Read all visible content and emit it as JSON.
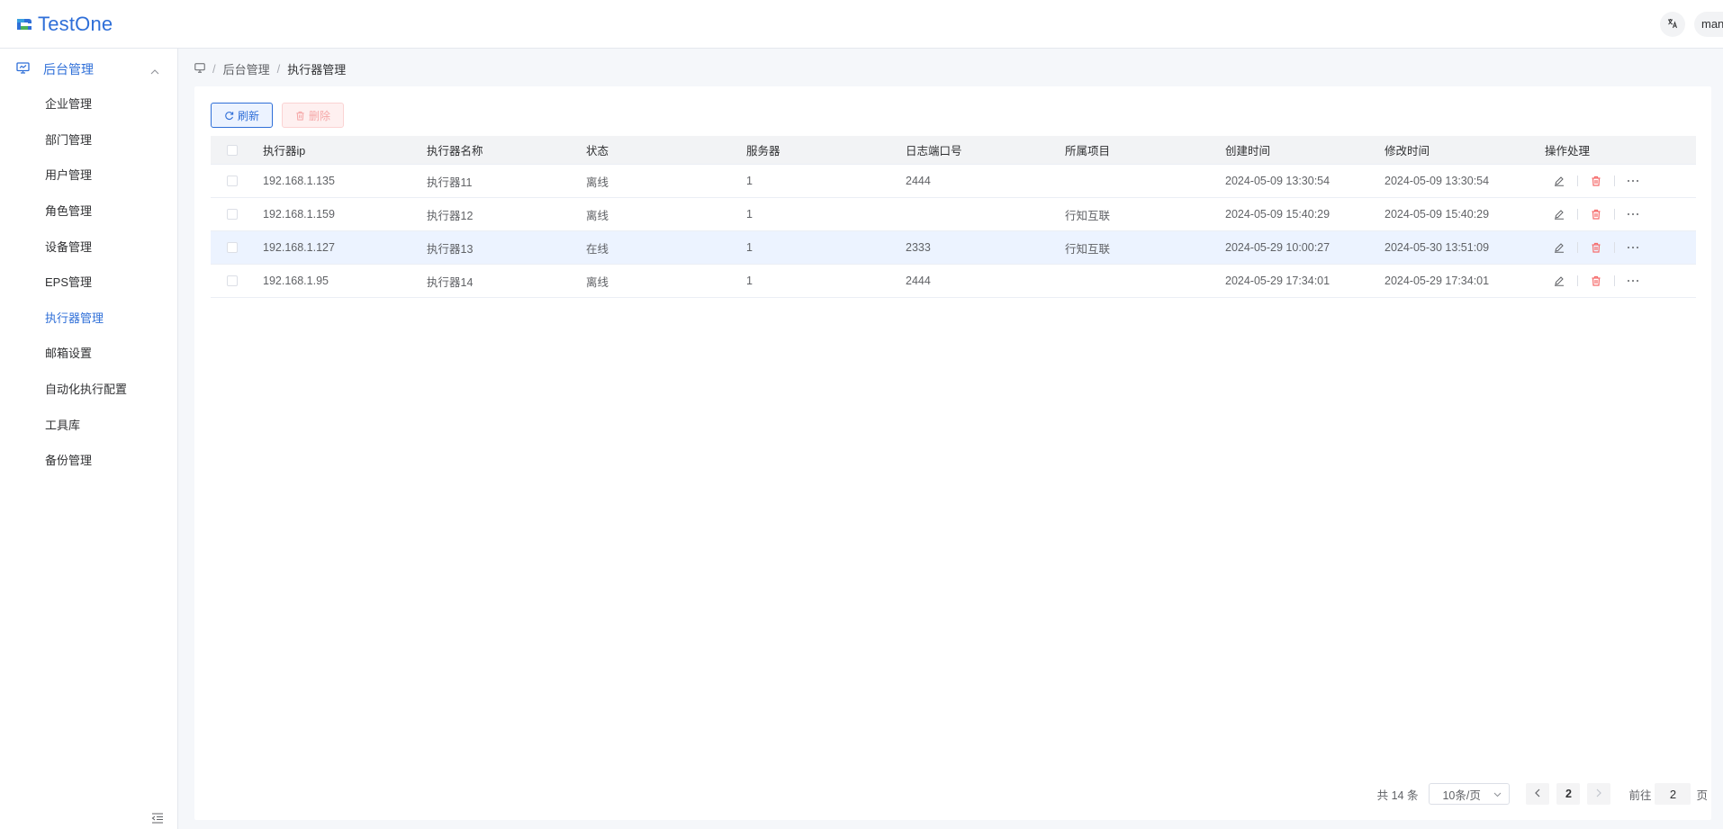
{
  "app": {
    "logo_text": "TestOne"
  },
  "header": {
    "user_label": "manager"
  },
  "sidebar": {
    "group_label": "后台管理",
    "items": [
      {
        "label": "企业管理",
        "active": false
      },
      {
        "label": "部门管理",
        "active": false
      },
      {
        "label": "用户管理",
        "active": false
      },
      {
        "label": "角色管理",
        "active": false
      },
      {
        "label": "设备管理",
        "active": false
      },
      {
        "label": "EPS管理",
        "active": false
      },
      {
        "label": "执行器管理",
        "active": true
      },
      {
        "label": "邮箱设置",
        "active": false
      },
      {
        "label": "自动化执行配置",
        "active": false
      },
      {
        "label": "工具库",
        "active": false
      },
      {
        "label": "备份管理",
        "active": false
      }
    ]
  },
  "breadcrumb": {
    "items": [
      "后台管理",
      "执行器管理"
    ]
  },
  "toolbar": {
    "refresh_label": "刷新",
    "delete_label": "删除"
  },
  "table": {
    "columns": [
      "执行器ip",
      "执行器名称",
      "状态",
      "服务器",
      "日志端口号",
      "所属项目",
      "创建时间",
      "修改时间",
      "操作处理"
    ],
    "rows": [
      {
        "ip": "192.168.1.135",
        "name": "执行器11",
        "state": "离线",
        "server": "1",
        "port": "2444",
        "project": "",
        "created": "2024-05-09 13:30:54",
        "modified": "2024-05-09 13:30:54"
      },
      {
        "ip": "192.168.1.159",
        "name": "执行器12",
        "state": "离线",
        "server": "1",
        "port": "",
        "project": "行知互联",
        "created": "2024-05-09 15:40:29",
        "modified": "2024-05-09 15:40:29"
      },
      {
        "ip": "192.168.1.127",
        "name": "执行器13",
        "state": "在线",
        "server": "1",
        "port": "2333",
        "project": "行知互联",
        "created": "2024-05-29 10:00:27",
        "modified": "2024-05-30 13:51:09"
      },
      {
        "ip": "192.168.1.95",
        "name": "执行器14",
        "state": "离线",
        "server": "1",
        "port": "2444",
        "project": "",
        "created": "2024-05-29 17:34:01",
        "modified": "2024-05-29 17:34:01"
      }
    ],
    "highlighted_row": 2
  },
  "pagination": {
    "total_text": "共 14 条",
    "page_size_text": "10条/页",
    "current_page": "2",
    "jump_label": "前往",
    "jump_value": "2",
    "jump_suffix": "页"
  },
  "colors": {
    "primary": "#2f6fd8",
    "danger": "#f56c6c",
    "highlight_row": "#ecf3ff"
  }
}
